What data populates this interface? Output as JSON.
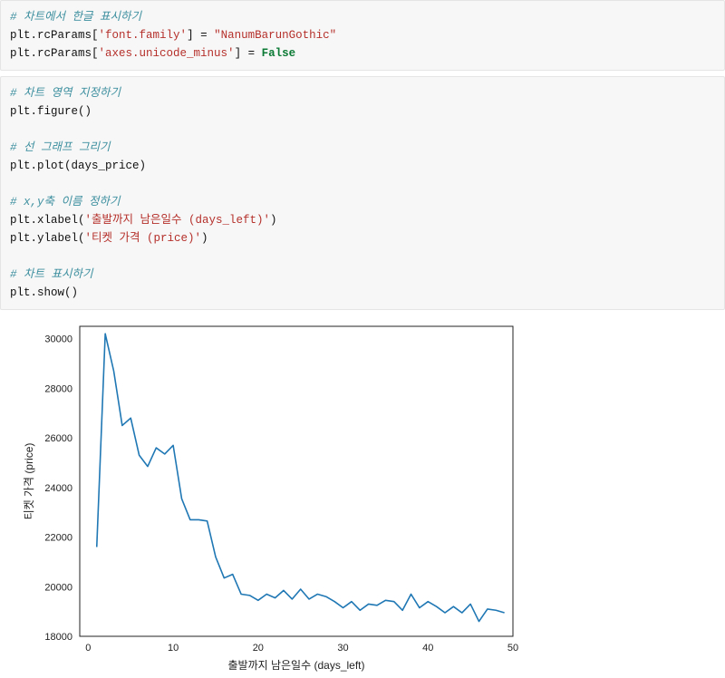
{
  "code": {
    "block1": {
      "l1_comment": "# 차트에서 한글 표시하기",
      "l2_a": "plt",
      "l2_b": ".rcParams[",
      "l2_c": "'font.family'",
      "l2_d": "] = ",
      "l2_e": "\"NanumBarunGothic\"",
      "l3_a": "plt",
      "l3_b": ".rcParams[",
      "l3_c": "'axes.unicode_minus'",
      "l3_d": "] = ",
      "l3_e": "False"
    },
    "block2": {
      "l1_comment": "# 차트 영역 지정하기",
      "l2": "plt.figure()",
      "l3_blank": "",
      "l4_comment": "# 선 그래프 그리기",
      "l5": "plt.plot(days_price)",
      "l6_blank": "",
      "l7_comment": "# x,y축 이름 정하기",
      "l8_a": "plt.xlabel(",
      "l8_b": "'출발까지 남은일수 (days_left)'",
      "l8_c": ")",
      "l9_a": "plt.ylabel(",
      "l9_b": "'티켓 가격 (price)'",
      "l9_c": ")",
      "l10_blank": "",
      "l11_comment": "# 차트 표시하기",
      "l12": "plt.show()"
    }
  },
  "chart_data": {
    "type": "line",
    "title": "",
    "xlabel": "출발까지 남은일수 (days_left)",
    "ylabel": "티켓 가격 (price)",
    "xlim": [
      -1,
      50
    ],
    "ylim": [
      18000,
      30500
    ],
    "xticks": [
      0,
      10,
      20,
      30,
      40,
      50
    ],
    "yticks": [
      18000,
      20000,
      22000,
      24000,
      26000,
      28000,
      30000
    ],
    "x": [
      1,
      2,
      3,
      4,
      5,
      6,
      7,
      8,
      9,
      10,
      11,
      12,
      13,
      14,
      15,
      16,
      17,
      18,
      19,
      20,
      21,
      22,
      23,
      24,
      25,
      26,
      27,
      28,
      29,
      30,
      31,
      32,
      33,
      34,
      35,
      36,
      37,
      38,
      39,
      40,
      41,
      42,
      43,
      44,
      45,
      46,
      47,
      48,
      49
    ],
    "values": [
      21600,
      30200,
      28700,
      26500,
      26800,
      25300,
      24850,
      25600,
      25350,
      25700,
      23550,
      22700,
      22700,
      22650,
      21200,
      20350,
      20500,
      19700,
      19650,
      19450,
      19700,
      19550,
      19850,
      19500,
      19900,
      19500,
      19700,
      19600,
      19400,
      19150,
      19400,
      19050,
      19300,
      19250,
      19450,
      19400,
      19050,
      19700,
      19150,
      19400,
      19200,
      18950,
      19200,
      18950,
      19300,
      18600,
      19100,
      19050,
      18950
    ]
  }
}
